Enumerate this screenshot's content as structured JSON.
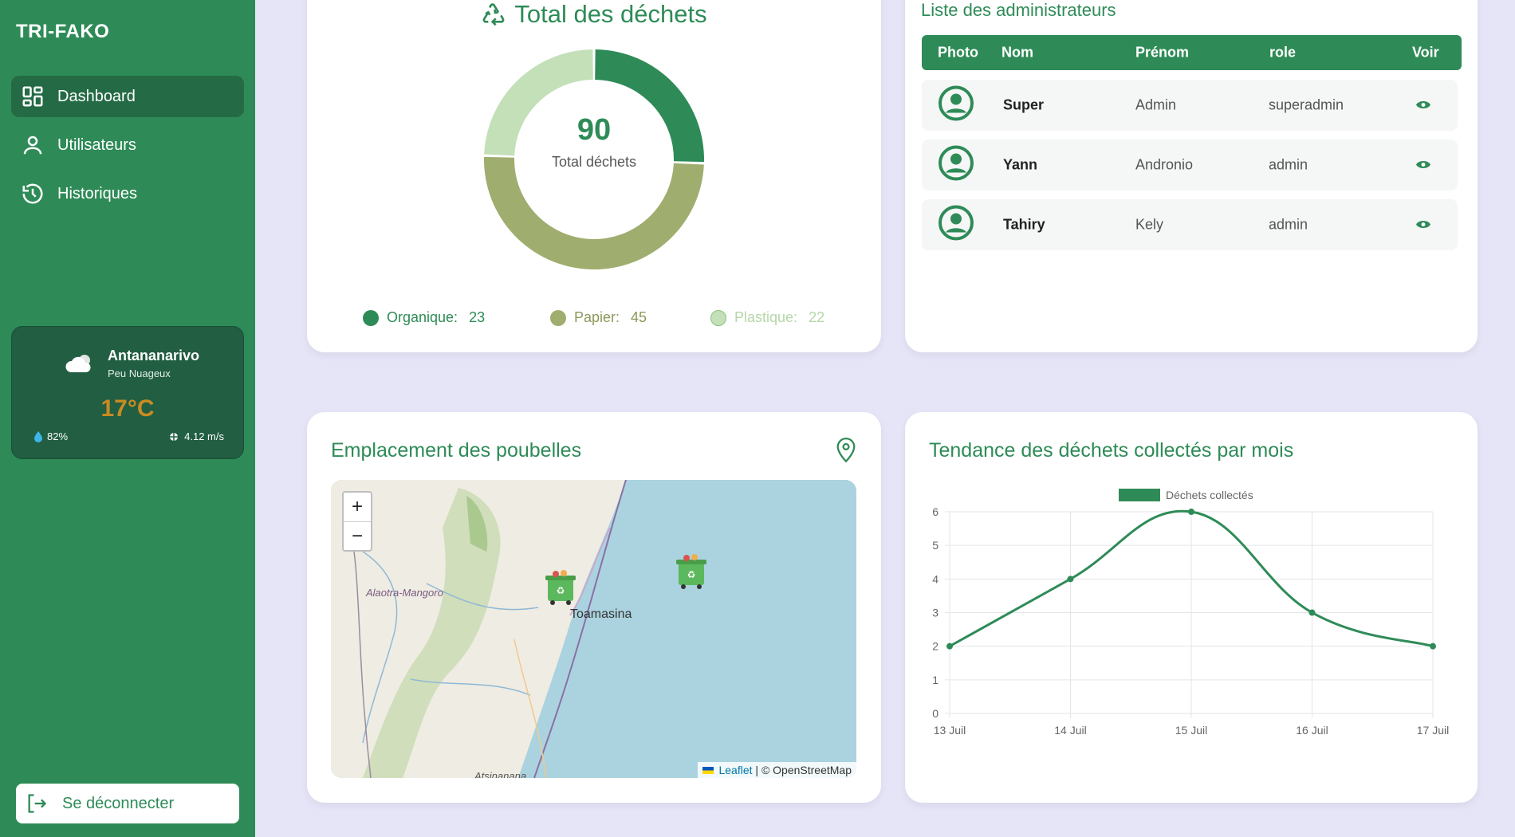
{
  "sidebar": {
    "brand": "TRI-FAKO",
    "items": [
      {
        "label": "Dashboard",
        "icon": "dashboard-icon",
        "active": true
      },
      {
        "label": "Utilisateurs",
        "icon": "user-icon",
        "active": false
      },
      {
        "label": "Historiques",
        "icon": "history-icon",
        "active": false
      }
    ],
    "weather": {
      "city": "Antananarivo",
      "description": "Peu Nuageux",
      "temperature": "17°C",
      "humidity": "82%",
      "wind": "4.12 m/s"
    },
    "logout_label": "Se déconnecter"
  },
  "donut": {
    "title": "Total des déchets",
    "total": "90",
    "total_label": "Total déchets",
    "legend": [
      {
        "label": "Organique:",
        "value": "23",
        "color": "#2e8b57"
      },
      {
        "label": "Papier:",
        "value": "45",
        "color": "#9fad6f"
      },
      {
        "label": "Plastique:",
        "value": "22",
        "color": "#c3e0b8"
      }
    ]
  },
  "admins": {
    "title": "Liste des administrateurs",
    "headers": [
      "Photo",
      "Nom",
      "Prénom",
      "role",
      "Voir"
    ],
    "rows": [
      {
        "nom": "Super",
        "prenom": "Admin",
        "role": "superadmin"
      },
      {
        "nom": "Yann",
        "prenom": "Andronio",
        "role": "admin"
      },
      {
        "nom": "Tahiry",
        "prenom": "Kely",
        "role": "admin"
      }
    ]
  },
  "map": {
    "title": "Emplacement des poubelles",
    "zoom_in": "+",
    "zoom_out": "−",
    "region_label": "Alaotra-Mangoro",
    "city_label": "Toamasina",
    "city_below": "Atsinanana",
    "attribution_link": "Leaflet",
    "attribution_text": "| © OpenStreetMap"
  },
  "trend": {
    "title": "Tendance des déchets collectés par mois"
  },
  "chart_data": {
    "type": "line",
    "categories": [
      "13 Juil",
      "14 Juil",
      "15 Juil",
      "16 Juil",
      "17 Juil"
    ],
    "series": [
      {
        "name": "Déchets collectés",
        "values": [
          2,
          4,
          6,
          3,
          2
        ],
        "color": "#2e8b57"
      }
    ],
    "ylim": [
      0,
      6
    ],
    "yticks": [
      0,
      1,
      2,
      3,
      4,
      5,
      6
    ],
    "grid": true,
    "legend": "top"
  }
}
